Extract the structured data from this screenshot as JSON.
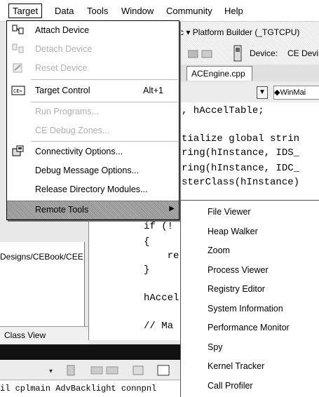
{
  "menubar": {
    "items": [
      "Target",
      "Data",
      "Tools",
      "Window",
      "Community",
      "Help"
    ]
  },
  "background": {
    "toolbar_title": "c ▾ Platform Builder (_TGTCPU)",
    "device_label": "Device:",
    "device_value": "CE Devi",
    "file_tab": "ACEngine.cpp",
    "function_combo": "◆WinMai",
    "left_path": "Designs/CEBook/CEE",
    "class_view": "Class View",
    "output_line": "il cplmain AdvBacklight connpnl",
    "code_lines": [
      ", hAccelTable;",
      "",
      "tialize global strin",
      "ring(hInstance, IDS_",
      "ring(hInstance, IDC_",
      "sterClass(hInstance)"
    ],
    "code_lines2": [
      "if (!",
      "{",
      "    re",
      "}",
      "",
      "hAccel",
      "",
      "// Ma"
    ]
  },
  "target_menu": {
    "items": [
      {
        "label": "Attach Device",
        "shortcut": "",
        "enabled": true,
        "icon": "attach-device-icon"
      },
      {
        "label": "Detach Device",
        "shortcut": "",
        "enabled": false,
        "icon": "detach-device-icon"
      },
      {
        "label": "Reset Device",
        "shortcut": "",
        "enabled": false,
        "icon": "reset-device-icon"
      },
      {
        "label": "Target Control",
        "shortcut": "Alt+1",
        "enabled": true,
        "icon": "target-control-icon"
      },
      {
        "label": "Run Programs...",
        "shortcut": "",
        "enabled": false,
        "icon": ""
      },
      {
        "label": "CE Debug Zones...",
        "shortcut": "",
        "enabled": false,
        "icon": ""
      },
      {
        "label": "Connectivity Options...",
        "shortcut": "",
        "enabled": true,
        "icon": "connectivity-options-icon"
      },
      {
        "label": "Debug Message Options...",
        "shortcut": "",
        "enabled": true,
        "icon": ""
      },
      {
        "label": "Release Directory Modules...",
        "shortcut": "",
        "enabled": true,
        "icon": ""
      },
      {
        "label": "Remote Tools",
        "shortcut": "",
        "enabled": true,
        "icon": "",
        "submenu": true
      }
    ]
  },
  "remote_tools_submenu": {
    "items": [
      "File Viewer",
      "Heap Walker",
      "Zoom",
      "Process Viewer",
      "Registry Editor",
      "System Information",
      "Performance Monitor",
      "Spy",
      "Kernel Tracker",
      "Call Profiler"
    ]
  }
}
